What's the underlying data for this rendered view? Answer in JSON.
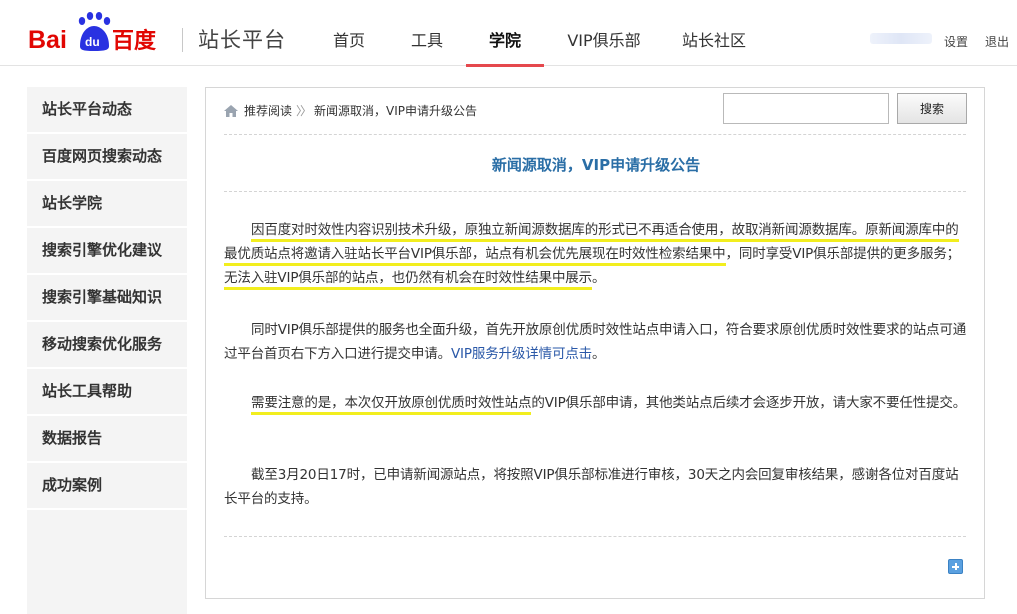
{
  "header": {
    "site_title": "站长平台",
    "nav": [
      {
        "label": "首页",
        "active": false
      },
      {
        "label": "工具",
        "active": false
      },
      {
        "label": "学院",
        "active": true
      },
      {
        "label": "VIP俱乐部",
        "active": false
      },
      {
        "label": "站长社区",
        "active": false
      }
    ],
    "settings_label": "设置",
    "logout_label": "退出"
  },
  "sidebar": {
    "items": [
      {
        "label": "站长平台动态"
      },
      {
        "label": "百度网页搜索动态"
      },
      {
        "label": "站长学院"
      },
      {
        "label": "搜索引擎优化建议"
      },
      {
        "label": "搜索引擎基础知识"
      },
      {
        "label": "移动搜索优化服务"
      },
      {
        "label": "站长工具帮助"
      },
      {
        "label": "数据报告"
      },
      {
        "label": "成功案例"
      }
    ]
  },
  "breadcrumb": {
    "home_label": "推荐阅读",
    "separator": "〉〉",
    "current": "新闻源取消，VIP申请升级公告"
  },
  "search": {
    "value": "",
    "placeholder": "",
    "button_label": "搜索"
  },
  "article": {
    "title": "新闻源取消，VIP申请升级公告",
    "p1": {
      "a": "因百度对时效性内容识别技术升级，原独立新闻源数据库的形式已不再适合使用，故取消新闻源数据库。原新闻源库中的最优质站点将邀请入驻站长平台VIP俱乐部，站点有机会优先展现在时效性检索结果中",
      "b": "，同时享受VIP俱乐部提供的更多服务；",
      "c": "无法入驻VIP俱乐部的站点，也仍然有机会在时效性结果中展示",
      "d": "。"
    },
    "p2": {
      "text": "同时VIP俱乐部提供的服务也全面升级，首先开放原创优质时效性站点申请入口，符合要求原创优质时效性要求的站点可通过平台首页右下方入口进行提交申请。",
      "link": "VIP服务升级详情可点击",
      "end": "。"
    },
    "p3": {
      "highlight": "需要注意的是，本次仅开放原创优质时效性站点",
      "rest": "的VIP俱乐部申请，其他类站点后续才会逐步开放，请大家不要任性提交。"
    },
    "p4": "截至3月20日17时，已申请新闻源站点，将按照VIP俱乐部标准进行审核，30天之内会回复审核结果，感谢各位对百度站长平台的支持。"
  },
  "colors": {
    "brand_red": "#e10602",
    "brand_blue": "#2932e1",
    "title_blue": "#2a6ea6",
    "link_blue": "#2a58a8",
    "highlight_yellow": "#f2ee1e",
    "nav_active_underline": "#e5484d"
  },
  "icons": {
    "home": "home-icon",
    "paw": "baidu-paw-icon",
    "expand": "plus-icon"
  }
}
